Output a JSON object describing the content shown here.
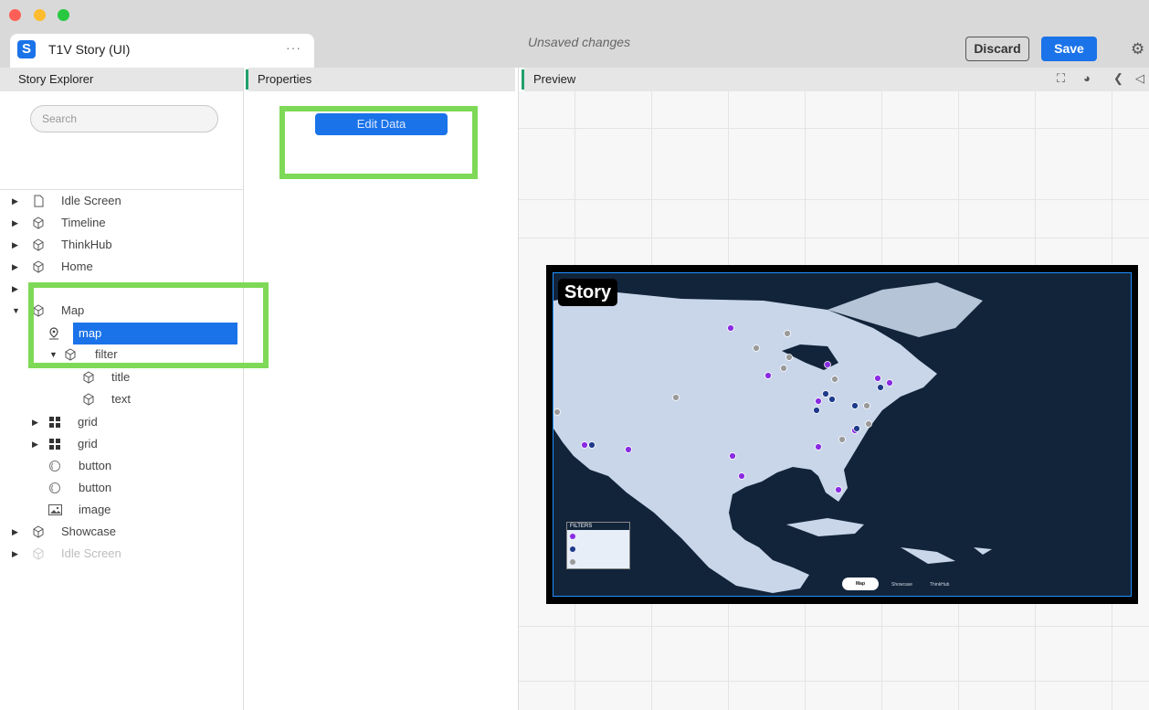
{
  "window": {
    "tab_title": "T1V Story (UI)",
    "tab_more": "···",
    "app_logo": "S",
    "status": "Unsaved changes",
    "discard_label": "Discard",
    "save_label": "Save",
    "settings_icon": "gear-icon"
  },
  "panels": {
    "explorer_title": "Story Explorer",
    "properties_title": "Properties",
    "preview_title": "Preview"
  },
  "explorer": {
    "search_placeholder": "Search",
    "items": [
      {
        "label": "Idle Screen"
      },
      {
        "label": "Timeline"
      },
      {
        "label": "ThinkHub"
      },
      {
        "label": "Home"
      },
      {
        "label": "Map"
      },
      {
        "label": "map"
      },
      {
        "label": "filter"
      },
      {
        "label": "title"
      },
      {
        "label": "text"
      },
      {
        "label": "grid"
      },
      {
        "label": "grid"
      },
      {
        "label": "button"
      },
      {
        "label": "button"
      },
      {
        "label": "image"
      },
      {
        "label": "Showcase"
      },
      {
        "label": "Idle Screen"
      }
    ]
  },
  "properties": {
    "edit_data_label": "Edit Data"
  },
  "preview_tools": [
    "expand-icon",
    "camera-icon",
    "back-icon",
    "volume-icon"
  ],
  "map_preview": {
    "logo_text": "Story",
    "filters_title": "FILTERS",
    "nav_active": "Map",
    "nav_items": [
      "Showcase",
      "ThinkHub"
    ]
  },
  "colors": {
    "accent_blue": "#1a73e8",
    "highlight_green": "#7ed957",
    "panel_accent": "#22a06b",
    "map_ocean": "#12243a",
    "map_land": "#c9d6ea",
    "pin_purple": "#8a2be2",
    "pin_navy": "#1e3a8a",
    "pin_gray": "#9a9a9a"
  }
}
